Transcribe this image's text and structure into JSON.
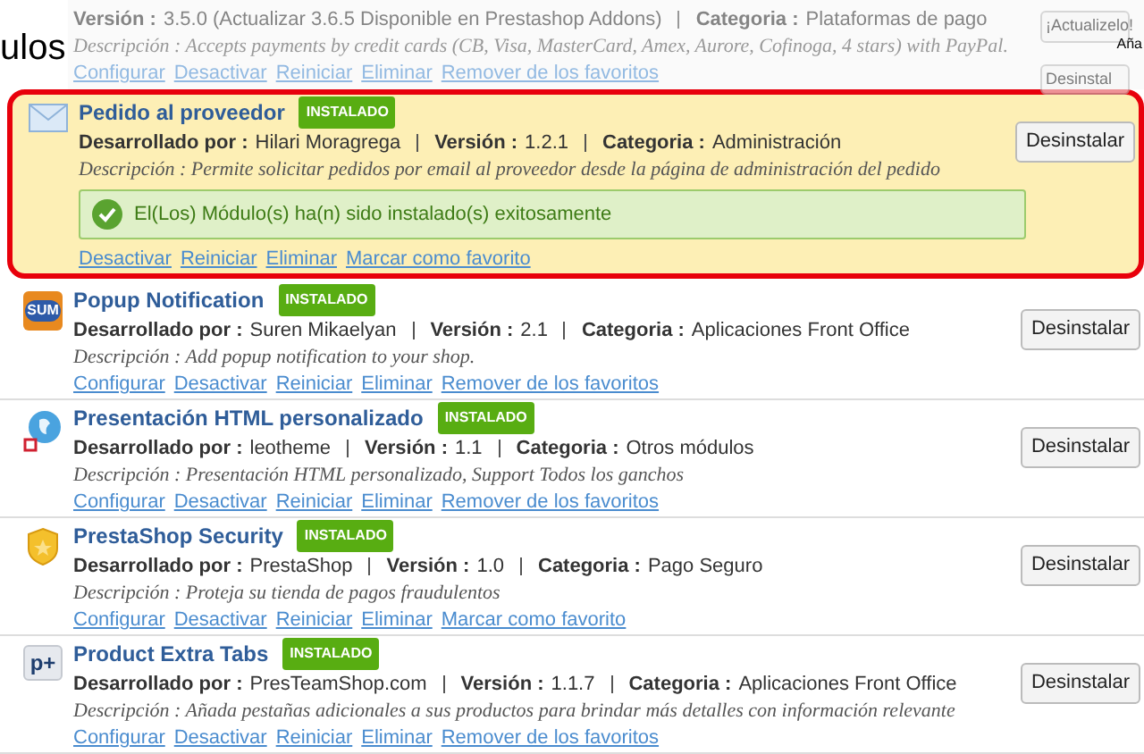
{
  "page_heading": "ulos",
  "corner_text": "Aña",
  "faded_module": {
    "details": [
      {
        "label": "Versión :",
        "value": "3.5.0 (Actualizar 3.6.5 Disponible en Prestashop Addons)"
      },
      {
        "label": "Categoria :",
        "value": "Plataformas de pago"
      }
    ],
    "description": "Descripción : Accepts payments by credit cards (CB, Visa, MasterCard, Amex, Aurore, Cofinoga, 4 stars) with PayPal.",
    "links": [
      "Configurar",
      "Desactivar",
      "Reiniciar",
      "Eliminar",
      "Remover de los favoritos"
    ],
    "buttons": [
      "¡Actualizelo!",
      "Desinstal"
    ]
  },
  "modules": [
    {
      "kind": "envelope",
      "name": "Pedido al proveedor",
      "badge": "INSTALADO",
      "highlighted": true,
      "details": [
        {
          "label": "Desarrollado por :",
          "value": "Hilari Moragrega"
        },
        {
          "label": "Versión :",
          "value": "1.2.1"
        },
        {
          "label": "Categoria :",
          "value": "Administración"
        }
      ],
      "description": "Descripción : Permite solicitar pedidos por email al proveedor desde la página de administración del pedido",
      "message": "El(Los) Módulo(s) ha(n) sido instalado(s) exitosamente",
      "links": [
        "Desactivar",
        "Reiniciar",
        "Eliminar",
        "Marcar como favorito"
      ],
      "button": "Desinstalar"
    },
    {
      "kind": "logo",
      "logo_text": "SUM",
      "name": "Popup Notification",
      "badge": "INSTALADO",
      "highlighted": false,
      "details": [
        {
          "label": "Desarrollado por :",
          "value": "Suren Mikaelyan"
        },
        {
          "label": "Versión :",
          "value": "2.1"
        },
        {
          "label": "Categoria :",
          "value": "Aplicaciones Front Office"
        }
      ],
      "description": "Descripción : Add popup notification to your shop.",
      "links": [
        "Configurar",
        "Desactivar",
        "Reiniciar",
        "Eliminar",
        "Remover de los favoritos"
      ],
      "button": "Desinstalar"
    },
    {
      "kind": "globe",
      "name": "Presentación HTML personalizado",
      "badge": "INSTALADO",
      "highlighted": false,
      "details": [
        {
          "label": "Desarrollado por :",
          "value": "leotheme"
        },
        {
          "label": "Versión :",
          "value": "1.1"
        },
        {
          "label": "Categoria :",
          "value": "Otros módulos"
        }
      ],
      "description": "Descripción : Presentación HTML personalizado, Support Todos los ganchos",
      "links": [
        "Configurar",
        "Desactivar",
        "Reiniciar",
        "Eliminar",
        "Remover de los favoritos"
      ],
      "button": "Desinstalar"
    },
    {
      "kind": "shield",
      "name": "PrestaShop Security",
      "badge": "INSTALADO",
      "highlighted": false,
      "details": [
        {
          "label": "Desarrollado por :",
          "value": "PrestaShop"
        },
        {
          "label": "Versión :",
          "value": "1.0"
        },
        {
          "label": "Categoria :",
          "value": "Pago Seguro"
        }
      ],
      "description": "Descripción : Proteja su tienda de pagos fraudulentos",
      "links": [
        "Configurar",
        "Desactivar",
        "Reiniciar",
        "Eliminar",
        "Marcar como favorito"
      ],
      "button": "Desinstalar"
    },
    {
      "kind": "logo-light",
      "logo_text": "p+",
      "name": "Product Extra Tabs",
      "badge": "INSTALADO",
      "highlighted": false,
      "details": [
        {
          "label": "Desarrollado por :",
          "value": "PresTeamShop.com"
        },
        {
          "label": "Versión :",
          "value": "1.1.7"
        },
        {
          "label": "Categoria :",
          "value": "Aplicaciones Front Office"
        }
      ],
      "description": "Descripción : Añada pestañas adicionales a sus productos para brindar más detalles con información relevante",
      "links": [
        "Configurar",
        "Desactivar",
        "Reiniciar",
        "Eliminar",
        "Remover de los favoritos"
      ],
      "button": "Desinstalar"
    }
  ]
}
